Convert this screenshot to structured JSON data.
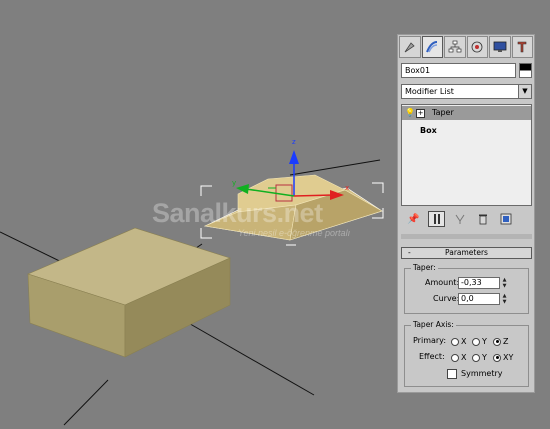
{
  "viewport": {
    "watermark": "Sanalkurs.net",
    "watermark_sub": "Yeni nesil e-öğrenme portalı",
    "gizmo_z_label": "z",
    "gizmo_x_label": "x",
    "gizmo_y_label": "y",
    "box_color": "#bdb180",
    "box_selected_color": "#d8c48c",
    "gizmo_z_color": "#1a3cff",
    "gizmo_x_color": "#e02020",
    "gizmo_y_color": "#10b020"
  },
  "command_panel": {
    "tabs": [
      "create-icon",
      "modify-icon",
      "hierarchy-icon",
      "motion-icon",
      "display-icon",
      "utilities-icon"
    ],
    "object_name": "Box01",
    "modifier_list_label": "Modifier List",
    "stack": {
      "items": [
        {
          "label": "Taper",
          "selected": true
        },
        {
          "label": "Box",
          "selected": false
        }
      ]
    },
    "parameters": {
      "rollout_title": "Parameters",
      "rollout_toggle": "-",
      "taper": {
        "group_label": "Taper:",
        "amount_label": "Amount:",
        "amount_value": "-0,33",
        "curve_label": "Curve:",
        "curve_value": "0,0"
      },
      "taper_axis": {
        "group_label": "Taper Axis:",
        "primary_label": "Primary:",
        "primary_options": [
          "X",
          "Y",
          "Z"
        ],
        "primary_selected": "Z",
        "effect_label": "Effect:",
        "effect_options": [
          "X",
          "Y",
          "XY"
        ],
        "effect_selected": "XY",
        "symmetry_label": "Symmetry",
        "symmetry_checked": false
      }
    }
  }
}
